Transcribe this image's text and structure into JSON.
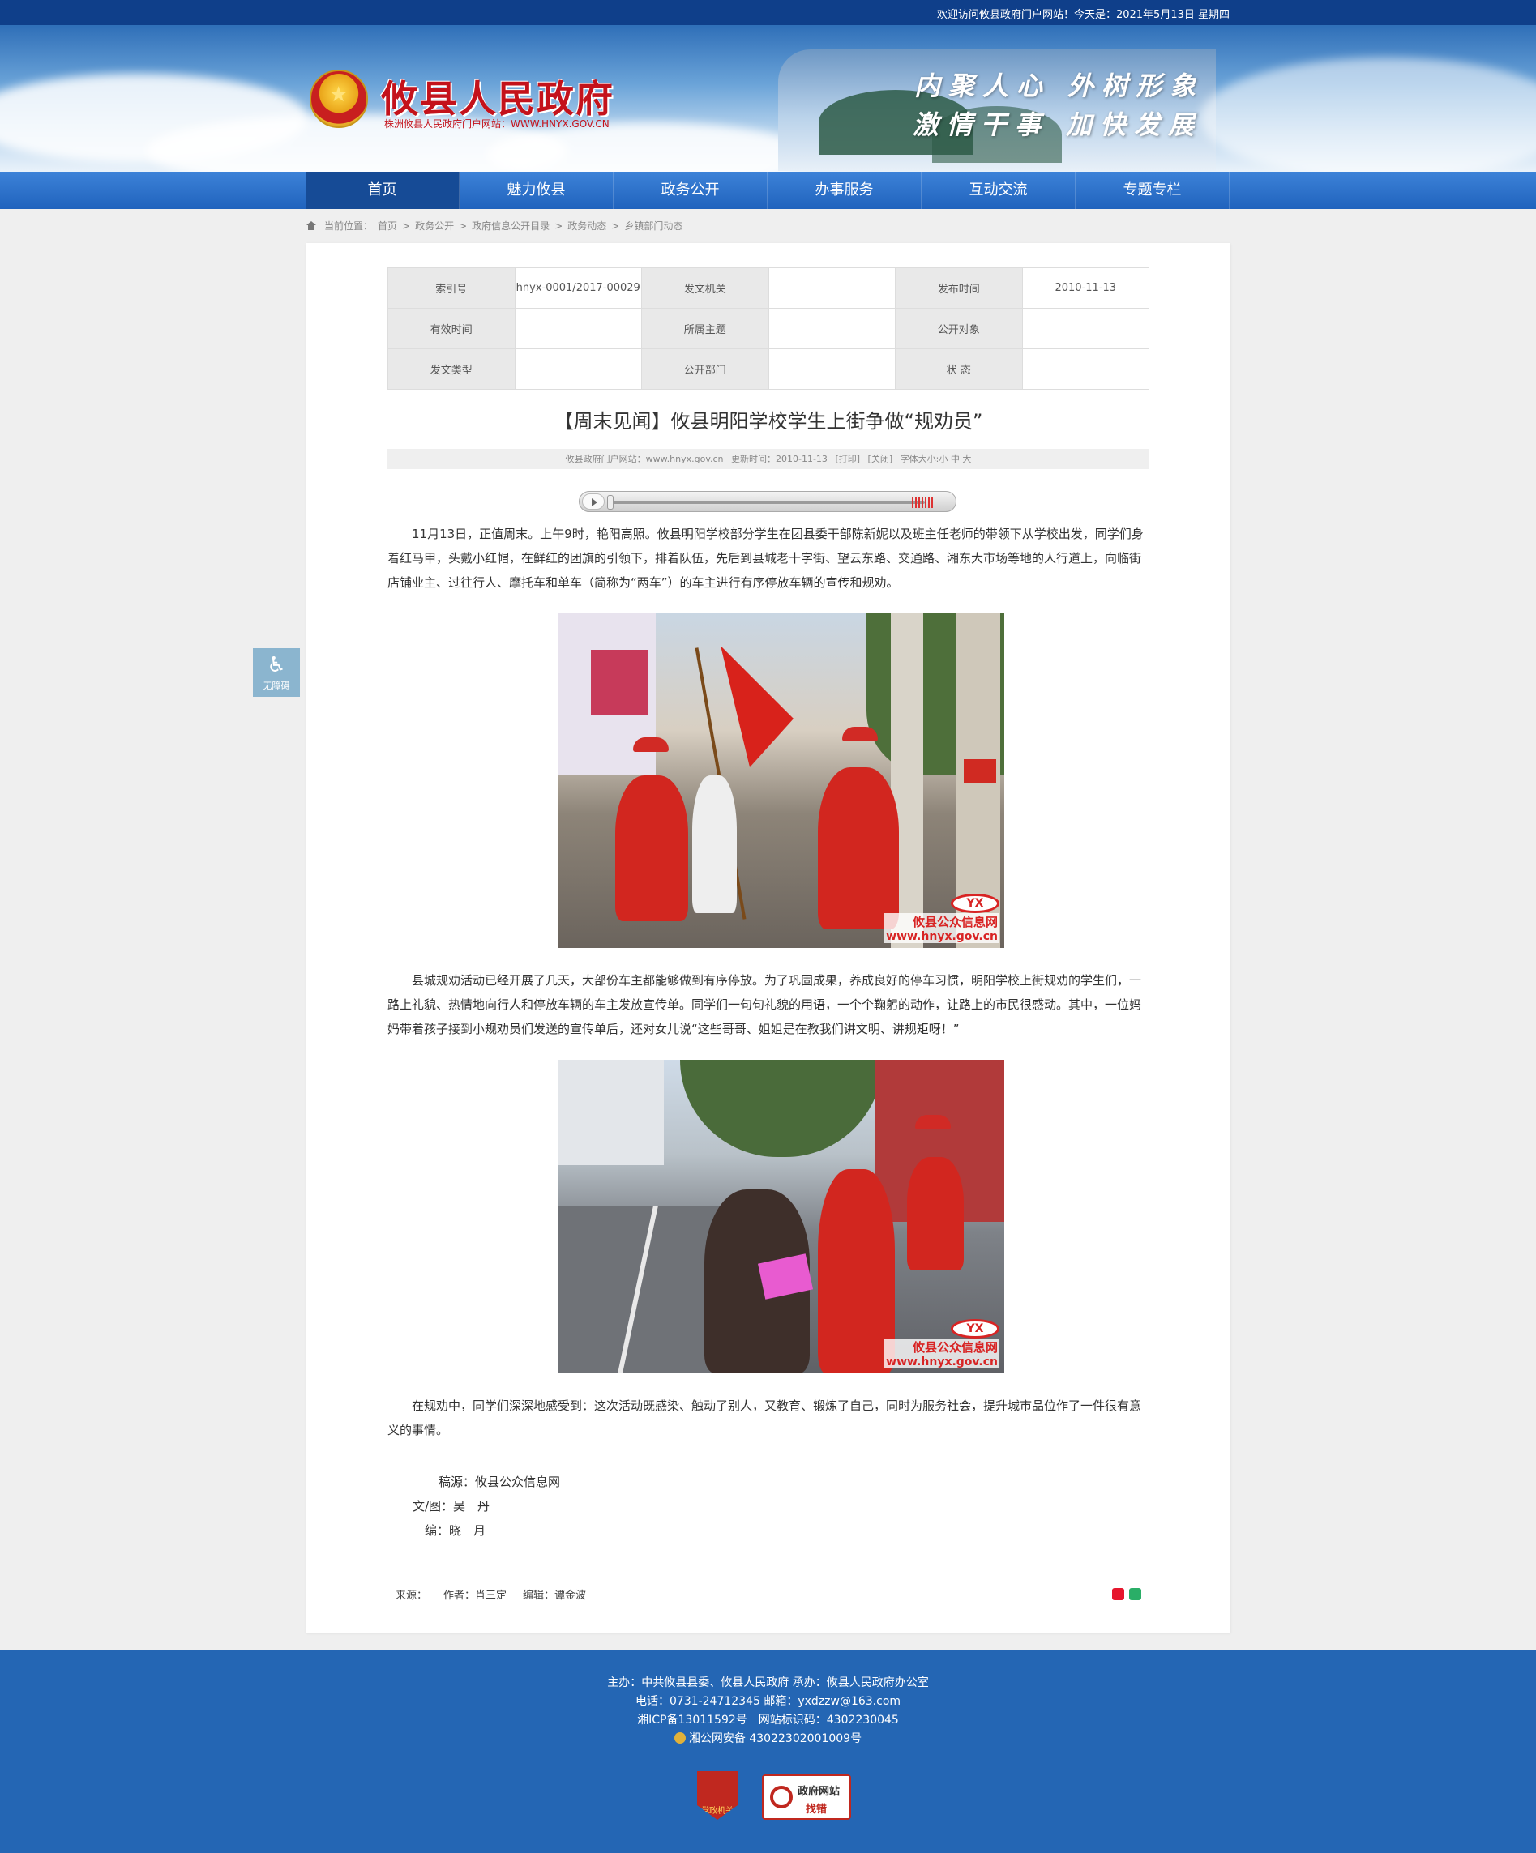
{
  "topbar": {
    "welcome": "欢迎访问攸县政府门户网站！今天是：2021年5月13日 星期四"
  },
  "header": {
    "site_title": "攸县人民政府",
    "site_subtitle": "株洲攸县人民政府门户网站：WWW.HNYX.GOV.CN",
    "slogan_line1": "内聚人心 外树形象",
    "slogan_line2": "激情干事 加快发展"
  },
  "nav": [
    "首页",
    "魅力攸县",
    "政务公开",
    "办事服务",
    "互动交流",
    "专题专栏"
  ],
  "breadcrumb": {
    "prefix": "当前位置：",
    "items": [
      "首页",
      "政务公开",
      "政府信息公开目录",
      "政务动态",
      "乡镇部门动态"
    ],
    "separator": ">"
  },
  "meta": {
    "index_label": "索引号",
    "index_value": "hnyx-0001/2017-00029",
    "issuer_label": "发文机关",
    "issuer_value": "",
    "date_label": "发布时间",
    "date_value": "2010-11-13",
    "validity_label": "有效时间",
    "validity_value": "",
    "topic_label": "所属主题",
    "topic_value": "",
    "audience_label": "公开对象",
    "audience_value": "",
    "type_label": "发文类型",
    "type_value": "",
    "dept_label": "公开部门",
    "dept_value": "",
    "status_label": "状 态",
    "status_value": ""
  },
  "article": {
    "title": "【周末见闻】攸县明阳学校学生上街争做“规劝员”",
    "source_site": "攸县政府门户网站：www.hnyx.gov.cn",
    "updated": "更新时间：2010-11-13",
    "print": "[打印]",
    "close": "[关闭]",
    "font_size": "字体大小:小 中 大",
    "para1": "11月13日，正值周末。上午9时，艳阳高照。攸县明阳学校部分学生在团县委干部陈新妮以及班主任老师的带领下从学校出发，同学们身着红马甲，头戴小红帽，在鲜红的团旗的引领下，排着队伍，先后到县城老十字街、望云东路、交通路、湘东大市场等地的人行道上，向临街店铺业主、过往行人、摩托车和单车（简称为“两车”）的车主进行有序停放车辆的宣传和规劝。",
    "para2": "县城规劝活动已经开展了几天，大部份车主都能够做到有序停放。为了巩固成果，养成良好的停车习惯，明阳学校上街规劝的学生们，一路上礼貌、热情地向行人和停放车辆的车主发放宣传单。同学们一句句礼貌的用语，一个个鞠躬的动作，让路上的市民很感动。其中，一位妈妈带着孩子接到小规劝员们发送的宣传单后，还对女儿说“这些哥哥、姐姐是在教我们讲文明、讲规矩呀！”",
    "para3": "在规劝中，同学们深深地感受到：这次活动既感染、触动了别人，又教育、锻炼了自己，同时为服务社会，提升城市品位作了一件很有意义的事情。",
    "credit_source": "稿源：攸县公众信息网",
    "credit_author": "文/图：吴　丹",
    "credit_editor": "编：晓　月",
    "watermark_logo": "YX",
    "watermark_name": "攸县公众信息网",
    "watermark_url": "www.hnyx.gov.cn"
  },
  "article_footer": {
    "source": "来源：",
    "author": "作者：肖三定",
    "editor": "编辑：谭金波"
  },
  "accessibility": {
    "label": "无障碍"
  },
  "footer": {
    "line1": "主办：中共攸县县委、攸县人民政府 承办：攸县人民政府办公室",
    "line2": "电话：0731-24712345 邮箱：yxdzzw@163.com",
    "line3": "湘ICP备13011592号　网站标识码：4302230045",
    "line4": "湘公网安备 43022302001009号",
    "badge_party": "党政机关",
    "badge_error_1": "政府网站",
    "badge_error_2": "找错"
  }
}
